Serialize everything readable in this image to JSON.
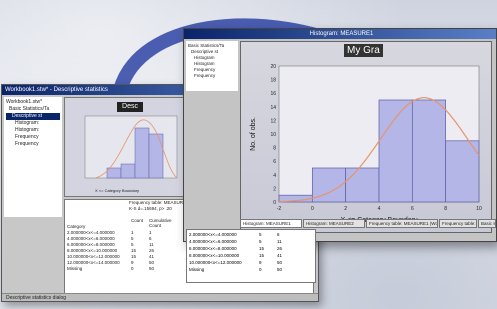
{
  "back_window": {
    "title": "Workbook1.stw* - Descriptive statistics",
    "tree": [
      "Workbook1.stw*",
      "Basic Statistics/Ta",
      "Descriptive st",
      "Histogram:",
      "Histogram:",
      "Frequency",
      "Frequency"
    ],
    "small_graph_title": "Desc",
    "small_xlabel": "X <= Category Boundary",
    "sheet_header": "Frequency table: MEASURE1",
    "sheet_subheader": "K-S d=.15694, p> .20",
    "col_count": "Count",
    "col_cumulative": "Cumulative Count",
    "row_label": "Category",
    "rows": [
      {
        "label": "2.000000<x<=4.000000",
        "count": "1",
        "cum": "1"
      },
      {
        "label": "4.000000<x<=6.000000",
        "count": "5",
        "cum": "6"
      },
      {
        "label": "6.000000<x<=8.000000",
        "count": "5",
        "cum": "11"
      },
      {
        "label": "8.000000<x<=10.000000",
        "count": "15",
        "cum": "26"
      },
      {
        "label": "10.000000<x<=12.000000",
        "count": "15",
        "cum": "41"
      },
      {
        "label": "12.000000<x<=14.000000",
        "count": "9",
        "cum": "50"
      },
      {
        "label": "Missing",
        "count": "0",
        "cum": "50"
      }
    ],
    "status_tab": "Descriptive statistics dialog"
  },
  "front_window": {
    "title": "Histogram: MEASURE1",
    "tree": [
      "Basic Statistics/Ta",
      "Descriptive st",
      "Histogram",
      "Histogram",
      "Frequency",
      "Frequency"
    ],
    "tabs": [
      "Histogram: MEASURE1",
      "Histogram: MEASURE2",
      "Frequency table: MEASURE1 (Workbook)",
      "Frequency table: Ma",
      "Basic st"
    ],
    "sheet_rows": [
      {
        "label": "2.000000<x<=4.000000",
        "count": "5",
        "cum": "6"
      },
      {
        "label": "4.000000<x<=6.000000",
        "count": "5",
        "cum": "11"
      },
      {
        "label": "6.000000<x<=8.000000",
        "count": "15",
        "cum": "26"
      },
      {
        "label": "8.000000<x<=10.000000",
        "count": "15",
        "cum": "41"
      },
      {
        "label": "10.000000<x<=12.000000",
        "count": "9",
        "cum": "50"
      },
      {
        "label": "Missing",
        "count": "0",
        "cum": "50"
      }
    ]
  },
  "chart_data": {
    "type": "bar",
    "title": "My Gra",
    "xlabel": "X <= Category Boundary",
    "ylabel": "No. of obs.",
    "x_ticks": [
      "-2",
      "0",
      "2",
      "4",
      "6",
      "8",
      "10"
    ],
    "y_ticks": [
      "0",
      "2",
      "4",
      "6",
      "8",
      "10",
      "12",
      "14",
      "16",
      "18",
      "20"
    ],
    "xlim": [
      -2,
      10
    ],
    "ylim": [
      0,
      20
    ],
    "bin_edges": [
      0,
      2,
      4,
      6,
      8,
      10
    ],
    "values": [
      1,
      5,
      5,
      15,
      15,
      9
    ],
    "bins": [
      [
        -2,
        0
      ],
      [
        0,
        2
      ],
      [
        2,
        4
      ],
      [
        4,
        6
      ],
      [
        6,
        8
      ],
      [
        8,
        10
      ]
    ],
    "fit_curve": "normal",
    "bar_color": "#b3b6e6",
    "bar_stroke": "#5a5fa0",
    "curve_color": "#e8946a",
    "grid": false
  }
}
